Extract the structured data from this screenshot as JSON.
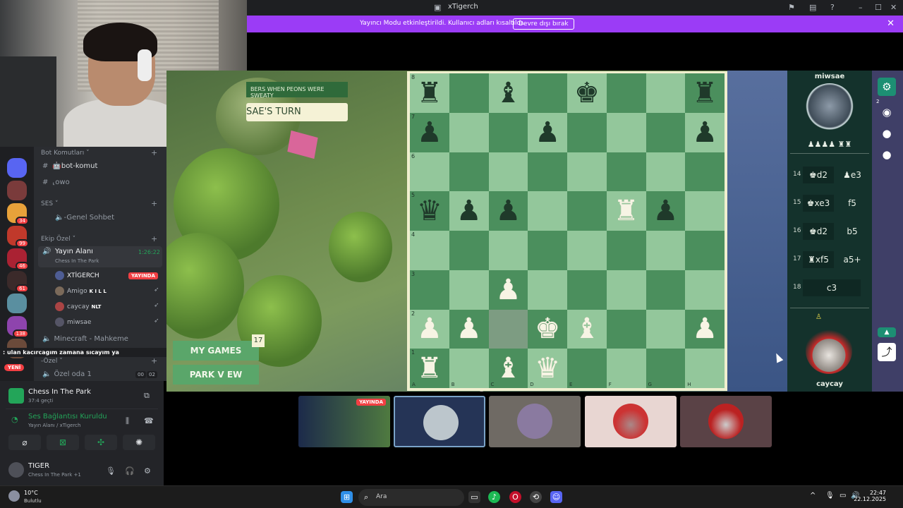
{
  "window": {
    "title": "xTigerch",
    "icons": [
      "flag-icon",
      "inbox-icon",
      "help-icon",
      "minimize-icon",
      "maximize-icon",
      "close-icon"
    ]
  },
  "banner": {
    "text": "Yayıncı Modu etkinleştirildi. Kullanıcı adları kısaltıldı.",
    "button": "Devre dışı bırak",
    "close": "✕"
  },
  "rail": {
    "badges": [
      "34",
      "99",
      "46",
      "61",
      "138"
    ],
    "new_label": "YENİ"
  },
  "channels": {
    "bot_category": "Bot Komutları ˅",
    "bot_komut": "🤖bot-komut",
    "owo": "⸤owo",
    "ses_category": "SES ˅",
    "genel_sohbet": "🔈-Genel Sohbet",
    "ekip_category": "Ekip Özel ˅",
    "yayin_alani": "Yayın Alanı",
    "yayin_activity": "Chess In The Park",
    "yayin_timer": "1:26:22",
    "members": [
      {
        "name": "XTİGERCH",
        "tag": "YAYINDA",
        "color": "#4e5d94"
      },
      {
        "name": "Amigo",
        "tag": "K I L L",
        "color": "#7b6a5a"
      },
      {
        "name": "caycay",
        "tag": "NLT",
        "color": "#a44"
      },
      {
        "name": "miwsae",
        "tag": "",
        "color": "#556"
      }
    ],
    "minecraft": "Minecraft - Mahkeme",
    "ticker": ": ulan kacırcagım zamana sıcayım ya",
    "ozel_category": "-Özel ˅",
    "ozel_oda": "Özel oda 1",
    "ozel_count_a": "00",
    "ozel_count_b": "02"
  },
  "activity": {
    "title": "Chess In The Park",
    "subtitle": "37:4 geçti"
  },
  "connection": {
    "title": "Ses Bağlantısı Kuruldu",
    "subtitle": "Yayın Alanı / xTigerch"
  },
  "me": {
    "name": "TIGER",
    "status": "Chess In The Park +1"
  },
  "game": {
    "notice": "BERS WHEN PEONS WERE SWEATY",
    "turn": "SAE'S TURN",
    "my_games": "MY GAMES",
    "my_games_badge": "17",
    "park_view": "PARK V EW",
    "ranks": [
      "8",
      "7",
      "6",
      "5",
      "4",
      "3",
      "2",
      "1"
    ],
    "files": [
      "A",
      "B",
      "C",
      "D",
      "E",
      "F",
      "G",
      "H"
    ],
    "board": [
      [
        "r",
        "",
        "b",
        "",
        "k",
        "",
        "",
        "r"
      ],
      [
        "p",
        "",
        "",
        "p",
        "",
        "",
        "",
        "p"
      ],
      [
        "",
        "",
        "",
        "",
        "",
        "",
        "",
        ""
      ],
      [
        "q",
        "p",
        "p",
        "",
        "",
        "R",
        "p",
        ""
      ],
      [
        "",
        "",
        "",
        "",
        "",
        "",
        "",
        ""
      ],
      [
        "",
        "",
        "P",
        "",
        "",
        "",
        "",
        ""
      ],
      [
        "P",
        "P",
        "",
        "K",
        "B",
        "",
        "",
        "P"
      ],
      [
        "R",
        "",
        "B",
        "Q",
        "",
        "",
        "",
        ""
      ]
    ]
  },
  "players": {
    "top": "miwsae",
    "bottom": "caycay",
    "top_captured": "♟♟♟♟ ♜♜",
    "bottom_captured": "♙"
  },
  "moves": [
    {
      "num": "14",
      "white": "♚d2",
      "black": "♟e3"
    },
    {
      "num": "15",
      "white": "♚xe3",
      "black": "f5"
    },
    {
      "num": "16",
      "white": "♚d2",
      "black": "b5"
    },
    {
      "num": "17",
      "white": "♜xf5",
      "black": "a5+"
    },
    {
      "num": "18",
      "white": "c3",
      "black": ""
    }
  ],
  "thumbnails": {
    "live_label": "YAYINDA"
  },
  "taskbar": {
    "weather_temp": "10°C",
    "weather_desc": "Bulutlu",
    "search_placeholder": "Ara",
    "time": "22:47",
    "date": "22.12.2025"
  },
  "colors": {
    "banner": "#9b3cf6",
    "board_dark": "#4b8f5d",
    "board_light": "#93c79b",
    "live_red": "#f23f43",
    "voice_green": "#23a559"
  }
}
